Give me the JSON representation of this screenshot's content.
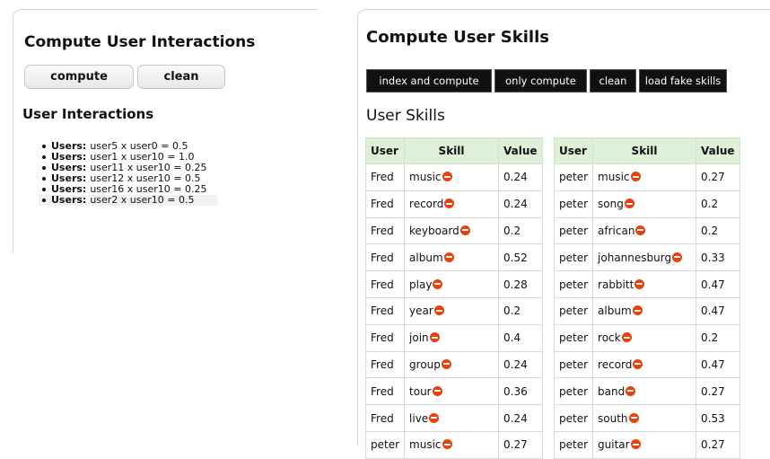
{
  "interactions_panel": {
    "title": "Compute User Interactions",
    "compute_label": "compute",
    "clean_label": "clean",
    "subtitle": "User Interactions",
    "items": [
      {
        "prefix": "Users:",
        "text": "user5 x user0 = 0.5"
      },
      {
        "prefix": "Users:",
        "text": "user1 x user10 = 1.0"
      },
      {
        "prefix": "Users:",
        "text": "user11 x user10 = 0.25"
      },
      {
        "prefix": "Users:",
        "text": "user12 x user10 = 0.5"
      },
      {
        "prefix": "Users:",
        "text": "user16 x user10 = 0.25"
      },
      {
        "prefix": "Users:",
        "text": "user2 x user10 = 0.5"
      }
    ]
  },
  "skills_panel": {
    "title": "Compute User Skills",
    "buttons": [
      "index and compute",
      "only compute",
      "clean",
      "load fake skills"
    ],
    "subtitle": "User Skills",
    "headers": {
      "user": "User",
      "skill": "Skill",
      "value": "Value"
    },
    "remove_icon": "remove-icon",
    "table1": [
      {
        "user": "Fred",
        "skill": "music",
        "value": "0.24"
      },
      {
        "user": "Fred",
        "skill": "record",
        "value": "0.24"
      },
      {
        "user": "Fred",
        "skill": "keyboard",
        "value": "0.2"
      },
      {
        "user": "Fred",
        "skill": "album",
        "value": "0.52"
      },
      {
        "user": "Fred",
        "skill": "play",
        "value": "0.28"
      },
      {
        "user": "Fred",
        "skill": "year",
        "value": "0.2"
      },
      {
        "user": "Fred",
        "skill": "join",
        "value": "0.4"
      },
      {
        "user": "Fred",
        "skill": "group",
        "value": "0.24"
      },
      {
        "user": "Fred",
        "skill": "tour",
        "value": "0.36"
      },
      {
        "user": "Fred",
        "skill": "live",
        "value": "0.24"
      },
      {
        "user": "peter",
        "skill": "music",
        "value": "0.27"
      }
    ],
    "table2": [
      {
        "user": "peter",
        "skill": "music",
        "value": "0.27"
      },
      {
        "user": "peter",
        "skill": "song",
        "value": "0.2"
      },
      {
        "user": "peter",
        "skill": "african",
        "value": "0.2"
      },
      {
        "user": "peter",
        "skill": "johannesburg",
        "value": "0.33"
      },
      {
        "user": "peter",
        "skill": "rabbitt",
        "value": "0.47"
      },
      {
        "user": "peter",
        "skill": "album",
        "value": "0.47"
      },
      {
        "user": "peter",
        "skill": "rock",
        "value": "0.2"
      },
      {
        "user": "peter",
        "skill": "record",
        "value": "0.47"
      },
      {
        "user": "peter",
        "skill": "band",
        "value": "0.27"
      },
      {
        "user": "peter",
        "skill": "south",
        "value": "0.53"
      },
      {
        "user": "peter",
        "skill": "guitar",
        "value": "0.27"
      }
    ]
  }
}
